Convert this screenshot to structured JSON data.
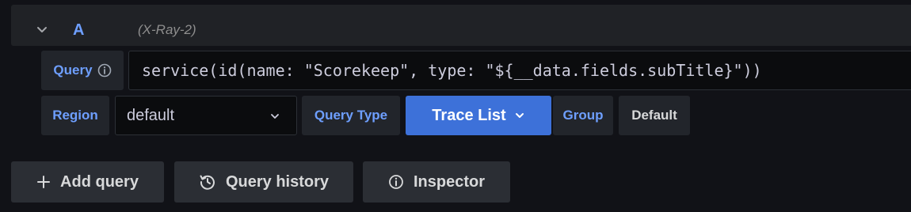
{
  "query_row": {
    "ref_id": "A",
    "datasource": "(X-Ray-2)"
  },
  "editor": {
    "query_label": "Query",
    "query_text": "service(id(name: \"Scorekeep\", type: \"${__data.fields.subTitle}\"))",
    "region_label": "Region",
    "region_value": "default",
    "query_type_label": "Query Type",
    "query_type_value": "Trace List",
    "group_label": "Group",
    "group_value": "Default"
  },
  "actions": {
    "add_query": "Add query",
    "query_history": "Query history",
    "inspector": "Inspector"
  },
  "icons": {
    "collapse": "chevron-down-icon",
    "query_info": "info-circle-icon",
    "region_dropdown": "chevron-down-icon",
    "query_type_dropdown": "chevron-down-icon",
    "add": "plus-icon",
    "history": "history-icon",
    "inspector": "info-circle-icon"
  },
  "colors": {
    "accent_text": "#6e9fff",
    "primary_button": "#3d71d9",
    "background": "#111217"
  }
}
